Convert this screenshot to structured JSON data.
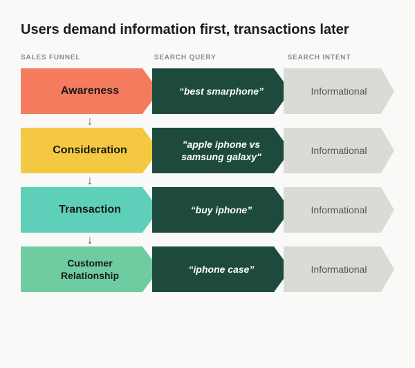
{
  "title": "Users demand information first, transactions later",
  "columns": {
    "col1": "SALES FUNNEL",
    "col2": "SEARCH QUERY",
    "col3": "SEARCH INTENT"
  },
  "rows": [
    {
      "id": "awareness",
      "funnel_label": "Awareness",
      "query_label": "“best smarphone”",
      "intent_label": "Informational",
      "funnel_color": "awareness",
      "has_down_arrow": true
    },
    {
      "id": "consideration",
      "funnel_label": "Consideration",
      "query_label": "“apple iphone vs\nsamsung galaxy”",
      "intent_label": "Informational",
      "funnel_color": "consideration",
      "has_down_arrow": true
    },
    {
      "id": "transaction",
      "funnel_label": "Transaction",
      "query_label": "“buy iphone”",
      "intent_label": "Informational",
      "funnel_color": "transaction",
      "has_down_arrow": true
    },
    {
      "id": "customer",
      "funnel_label": "Customer\nRelationship",
      "query_label": "“iphone case”",
      "intent_label": "Informational",
      "funnel_color": "customer",
      "has_down_arrow": false
    }
  ]
}
